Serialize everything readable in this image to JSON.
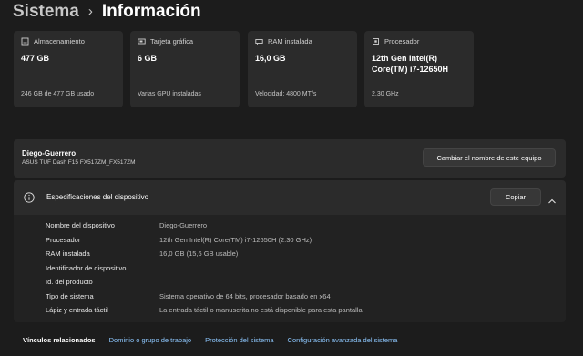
{
  "header": {
    "parent": "Sistema",
    "separator": "›",
    "current": "Información"
  },
  "cards": [
    {
      "title": "Almacenamiento",
      "value": "477 GB",
      "sub": "246 GB de 477 GB usado",
      "icon": "storage-icon"
    },
    {
      "title": "Tarjeta gráfica",
      "value": "6 GB",
      "sub": "Varias GPU instaladas",
      "icon": "gpu-icon"
    },
    {
      "title": "RAM instalada",
      "value": "16,0 GB",
      "sub": "Velocidad: 4800 MT/s",
      "icon": "ram-icon"
    },
    {
      "title": "Procesador",
      "value": "12th Gen Intel(R) Core(TM) i7-12650H",
      "sub": "2.30 GHz",
      "icon": "cpu-icon"
    }
  ],
  "device": {
    "name": "Diego-Guerrero",
    "model": "ASUS TUF Dash F15 FX517ZM_FX517ZM",
    "rename_label": "Cambiar el nombre de este equipo"
  },
  "specs": {
    "title": "Especificaciones del dispositivo",
    "copy_label": "Copiar",
    "rows": [
      {
        "label": "Nombre del dispositivo",
        "value": "Diego-Guerrero"
      },
      {
        "label": "Procesador",
        "value": "12th Gen Intel(R) Core(TM) i7-12650H (2.30 GHz)"
      },
      {
        "label": "RAM instalada",
        "value": "16,0 GB (15,6 GB usable)"
      },
      {
        "label": "Identificador de dispositivo",
        "value": ""
      },
      {
        "label": "Id. del producto",
        "value": ""
      },
      {
        "label": "Tipo de sistema",
        "value": "Sistema operativo de 64 bits, procesador basado en x64"
      },
      {
        "label": "Lápiz y entrada táctil",
        "value": "La entrada táctil o manuscrita no está disponible para esta pantalla"
      }
    ]
  },
  "related": {
    "label": "Vínculos relacionados",
    "links": [
      "Dominio o grupo de trabajo",
      "Protección del sistema",
      "Configuración avanzada del sistema"
    ]
  },
  "colors": {
    "background": "#1c1c1c",
    "card": "#2b2b2b",
    "link": "#8ec8ff"
  }
}
